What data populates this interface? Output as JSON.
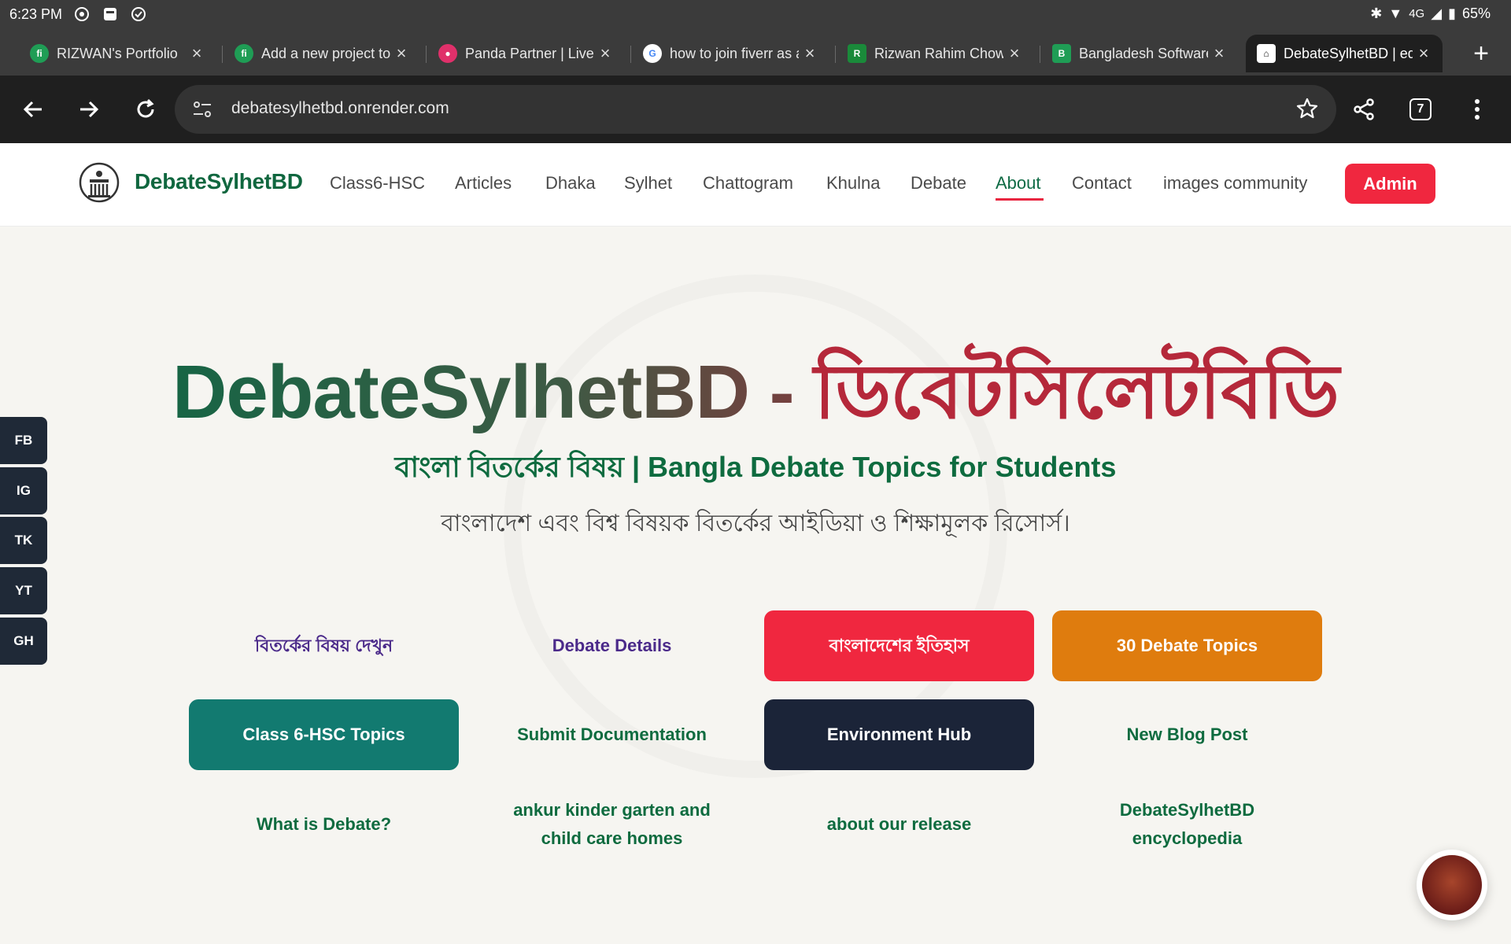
{
  "status": {
    "time": "6:23 PM",
    "network": "4G",
    "battery": "65%"
  },
  "tabs": [
    {
      "title": "RIZWAN's Portfolio",
      "fav_color": "#1f9d55",
      "fav_glyph": "fi"
    },
    {
      "title": "Add a new project to",
      "fav_color": "#1f9d55",
      "fav_glyph": "fi"
    },
    {
      "title": "Panda Partner | Live C",
      "fav_color": "#e0306a",
      "fav_glyph": "●"
    },
    {
      "title": "how to join fiverr as a",
      "fav_color": "#ffffff",
      "fav_glyph": "G"
    },
    {
      "title": "Rizwan Rahim Chowd",
      "fav_color": "#1a8a3a",
      "fav_glyph": "R"
    },
    {
      "title": "Bangladesh Software",
      "fav_color": "#1f9d55",
      "fav_glyph": "B"
    },
    {
      "title": "DebateSylhetBD | edu",
      "fav_color": "#ffffff",
      "fav_glyph": "⌂"
    }
  ],
  "toolbar": {
    "url": "debatesylhetbd.onrender.com",
    "tab_count": "7"
  },
  "site": {
    "brand": "DebateSylhetBD",
    "nav": [
      "Class6-HSC",
      "Articles",
      "Dhaka",
      "Sylhet",
      "Chattogram",
      "Khulna",
      "Debate",
      "About",
      "Contact",
      "images community"
    ],
    "admin": "Admin"
  },
  "hero": {
    "title_en": "DebateSylhetBD - ",
    "title_bn": "ডিবেটসিলেটবিডি",
    "subtitle": "বাংলা বিতর্কের বিষয় | Bangla Debate Topics for Students",
    "desc": "বাংলাদেশ এবং বিশ্ব বিষয়ক বিতর্কের আইডিয়া ও শিক্ষামূলক রিসোর্স।"
  },
  "cta": [
    "বিতর্কের বিষয় দেখুন",
    "Debate Details",
    "বাংলাদেশের ইতিহাস",
    "30 Debate Topics",
    "Class 6-HSC Topics",
    "Submit Documentation",
    "Environment Hub",
    "New Blog Post",
    "What is Debate?",
    "ankur kinder garten and child care homes",
    "about our release",
    "DebateSylhetBD encyclopedia"
  ],
  "social": [
    "FB",
    "IG",
    "TK",
    "YT",
    "GH"
  ],
  "colors": {
    "brand_green": "#10673f",
    "accent_red": "#f0273f",
    "orange": "#df7c0e",
    "teal": "#127a70",
    "navy": "#1b2438"
  }
}
